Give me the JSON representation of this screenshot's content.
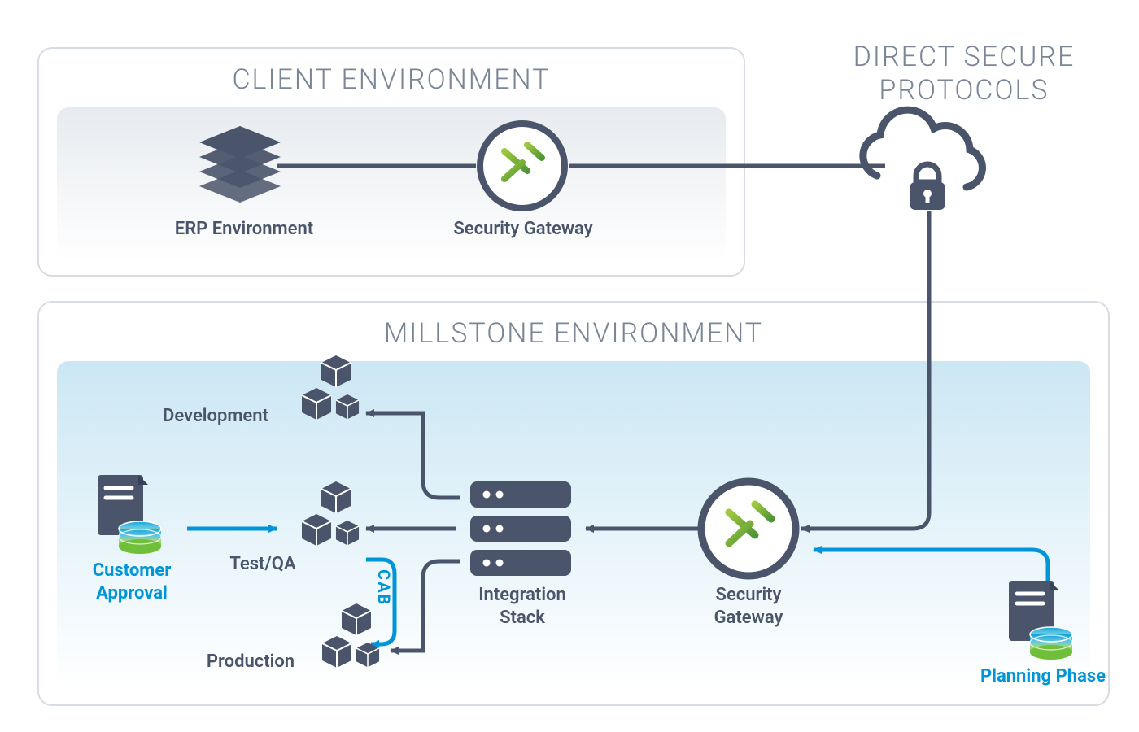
{
  "headings": {
    "client_env": "CLIENT ENVIRONMENT",
    "millstone_env": "MILLSTONE ENVIRONMENT",
    "direct_secure": "DIRECT SECURE\nPROTOCOLS"
  },
  "nodes": {
    "erp": "ERP Environment",
    "sec_gw_top": "Security Gateway",
    "development": "Development",
    "testqa": "Test/QA",
    "production": "Production",
    "integration_stack": "Integration\nStack",
    "sec_gw_bottom": "Security\nGateway",
    "customer_approval": "Customer\nApproval",
    "planning_phase": "Planning Phase",
    "cab": "CAB"
  },
  "colors": {
    "slate": "#4a556b",
    "accent_blue": "#0095d6",
    "accent_green_a": "#9fc83e",
    "accent_green_b": "#4f9536",
    "panel_border": "#d8dde3"
  }
}
